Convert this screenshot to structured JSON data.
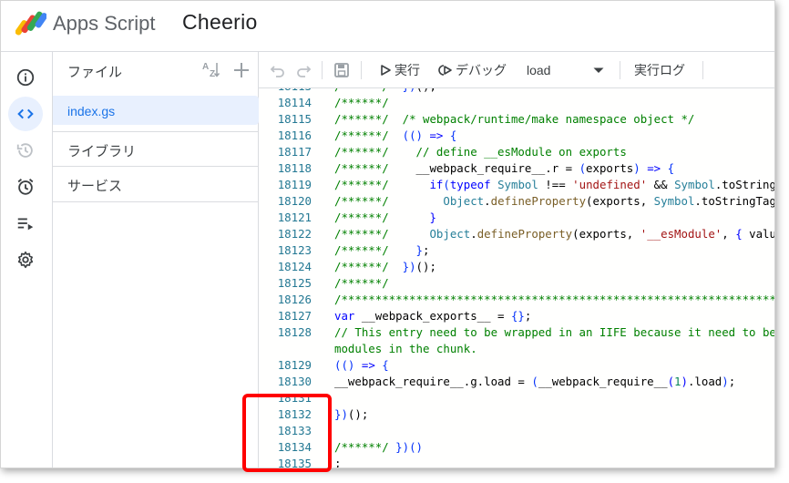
{
  "header": {
    "app_title": "Apps Script",
    "project_title": "Cheerio"
  },
  "rail": {
    "items": [
      {
        "icon": "info-icon"
      },
      {
        "icon": "code-icon",
        "active": true
      },
      {
        "icon": "history-icon"
      },
      {
        "icon": "alarm-icon"
      },
      {
        "icon": "executions-icon"
      },
      {
        "icon": "gear-icon"
      }
    ]
  },
  "files": {
    "title": "ファイル",
    "sort_icon": "sort-az-icon",
    "add_icon": "plus-icon",
    "current_file": "index.gs",
    "sections": [
      "ライブラリ",
      "サービス"
    ]
  },
  "toolbar": {
    "run_label": "実行",
    "debug_label": "デバッグ",
    "function_select": "load",
    "log_label": "実行ログ"
  },
  "editor": {
    "lines": [
      {
        "n": "18113",
        "html": "<span class=\"cm\">/******/</span>  <span class=\"bk\">})</span>();"
      },
      {
        "n": "18114",
        "html": "<span class=\"cm\">/******/</span>"
      },
      {
        "n": "18115",
        "html": "<span class=\"cm\">/******/</span>  <span class=\"cm\">/* webpack/runtime/make namespace object */</span>"
      },
      {
        "n": "18116",
        "html": "<span class=\"cm\">/******/</span>  <span class=\"bk\">(()</span> <span class=\"kw\">=&gt;</span> <span class=\"bk\">{</span>"
      },
      {
        "n": "18117",
        "html": "<span class=\"cm\">/******/</span>    <span class=\"cm\">// define __esModule on exports</span>"
      },
      {
        "n": "18118",
        "html": "<span class=\"cm\">/******/</span>    __webpack_require__.r = <span class=\"bk\">(</span>exports<span class=\"bk\">)</span> <span class=\"kw\">=&gt;</span> <span class=\"bk\">{</span>"
      },
      {
        "n": "18119",
        "html": "<span class=\"cm\">/******/</span>      <span class=\"kw\">if</span><span class=\"bk\">(</span><span class=\"kw\">typeof</span> <span class=\"ty\">Symbol</span> !== <span class=\"st\">'undefined'</span> &amp;&amp; <span class=\"ty\">Symbol</span>.toStringTag<span class=\"bk\">)</span>"
      },
      {
        "n": "18120",
        "html": "<span class=\"cm\">/******/</span>        <span class=\"ty\">Object</span>.<span class=\"fn\">defineProperty</span>(exports, <span class=\"ty\">Symbol</span>.toStringTag"
      },
      {
        "n": "18121",
        "html": "<span class=\"cm\">/******/</span>      <span class=\"kw\">}</span>"
      },
      {
        "n": "18122",
        "html": "<span class=\"cm\">/******/</span>      <span class=\"ty\">Object</span>.<span class=\"fn\">defineProperty</span>(exports, <span class=\"st\">'__esModule'</span>, <span class=\"kw\">{</span> value"
      },
      {
        "n": "18123",
        "html": "<span class=\"cm\">/******/</span>    <span class=\"bk\">}</span>;"
      },
      {
        "n": "18124",
        "html": "<span class=\"cm\">/******/</span>  <span class=\"bk\">})</span>();"
      },
      {
        "n": "18125",
        "html": "<span class=\"cm\">/******/</span>"
      },
      {
        "n": "18126",
        "html": "<span class=\"cm\">/************************************************************************/</span>"
      },
      {
        "n": "18127",
        "html": "<span class=\"kw\">var</span> __webpack_exports__ = <span class=\"bk\">{}</span>;"
      },
      {
        "n": "18128",
        "html": "<span class=\"cm\">// This entry need to be wrapped in an IIFE because it need to be isolated against other</span>"
      },
      {
        "n": "",
        "html": "<span class=\"cm\">modules in the chunk.</span>"
      },
      {
        "n": "18129",
        "html": "<span class=\"bk\">(()</span> <span class=\"kw\">=&gt;</span> <span class=\"bk\">{</span>"
      },
      {
        "n": "18130",
        "html": "__webpack_require__.g.load = <span class=\"bk\">(</span>__webpack_require__<span class=\"kw\">(</span><span class=\"nm\">1</span><span class=\"kw\">)</span>.load<span class=\"bk\">)</span>;"
      },
      {
        "n": "18131",
        "html": ""
      },
      {
        "n": "18132",
        "html": "<span class=\"bk\">})</span>();"
      },
      {
        "n": "18133",
        "html": ""
      },
      {
        "n": "18134",
        "html": "<span class=\"cm\">/******/</span> <span class=\"bk\">})()</span>"
      },
      {
        "n": "18135",
        "html": ";"
      }
    ]
  },
  "colors": {
    "accent": "#1a73e8",
    "annotation": "#ff0000"
  }
}
